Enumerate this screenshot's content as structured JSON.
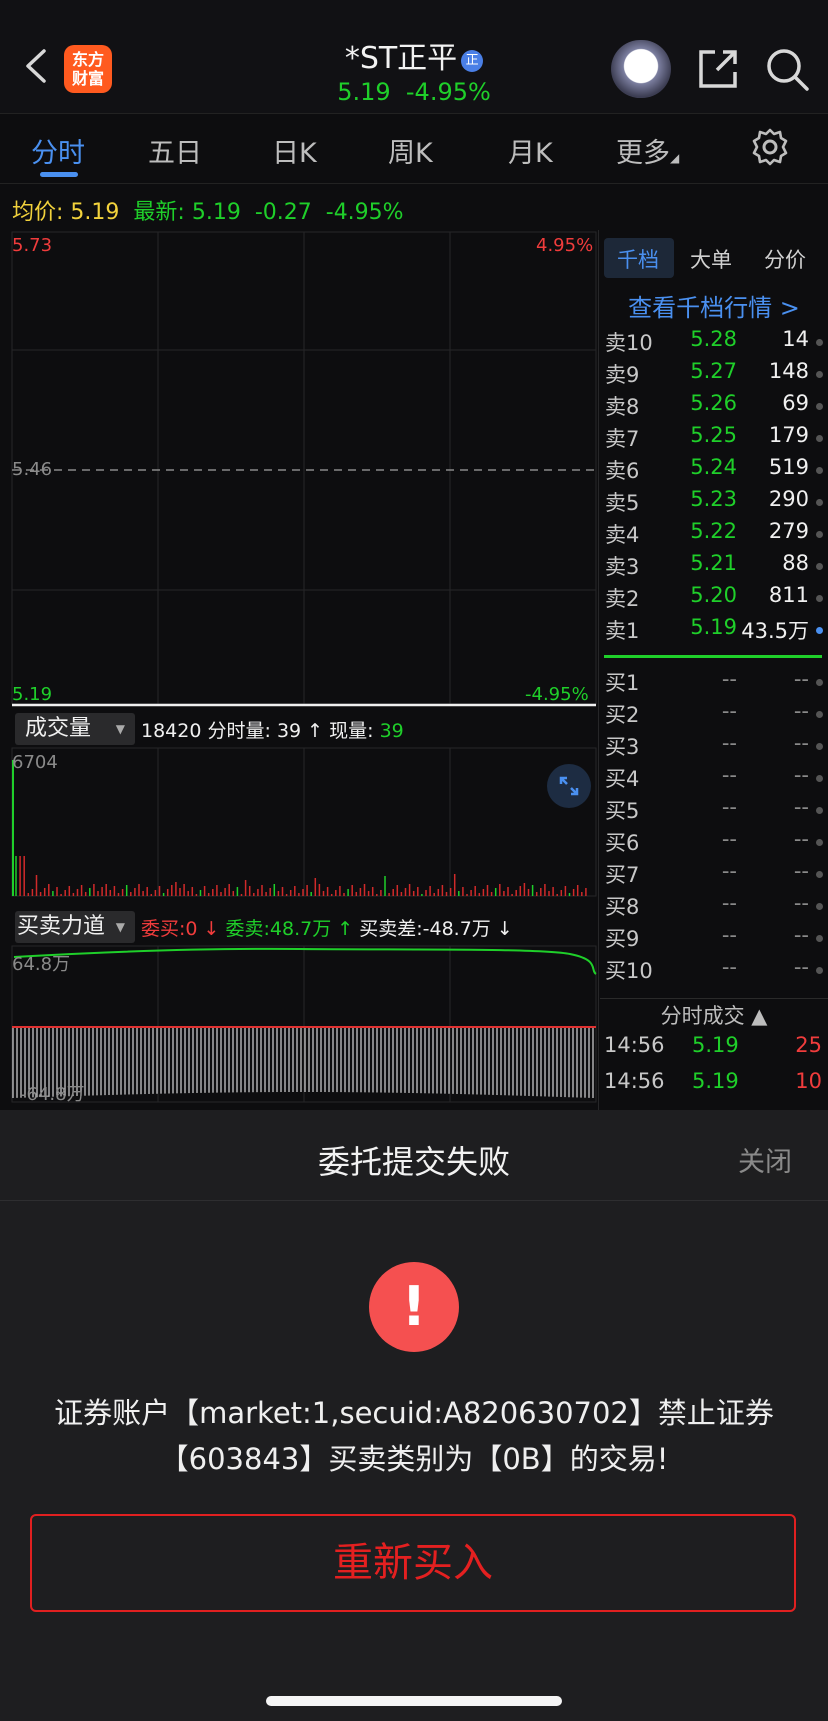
{
  "header": {
    "logo_text": "东方\n财富",
    "stock_name": "*ST正平",
    "badge": "正",
    "price": "5.19",
    "change_pct": "-4.95%"
  },
  "tabs": [
    "分时",
    "五日",
    "日K",
    "周K",
    "月K",
    "更多"
  ],
  "info_line": {
    "avg_label": "均价:",
    "avg_value": "5.19",
    "latest_label": "最新:",
    "latest_value": "5.19",
    "change": "-0.27",
    "change_pct": "-4.95%"
  },
  "price_chart": {
    "top_price": "5.73",
    "top_pct": "4.95%",
    "mid_price": "5.46",
    "bottom_price": "5.19",
    "bottom_pct": "-4.95%"
  },
  "volume": {
    "selector": "成交量",
    "total": "18420",
    "minute_label": "分时量:",
    "minute_value": "39",
    "now_label": "现量:",
    "now_value": "39",
    "max_label": "6704"
  },
  "force": {
    "selector": "买卖力道",
    "bid_label": "委买:0 ↓",
    "ask_label": "委卖:48.7万 ↑",
    "diff_label": "买卖差:-48.7万 ↓",
    "top_label": "64.8万",
    "bottom_label": "-64.8万"
  },
  "right_panel": {
    "tabs": [
      "千档",
      "大单",
      "分价"
    ],
    "view_depth": "查看千档行情 >",
    "asks": [
      {
        "label": "卖10",
        "price": "5.28",
        "qty": "14"
      },
      {
        "label": "卖9",
        "price": "5.27",
        "qty": "148"
      },
      {
        "label": "卖8",
        "price": "5.26",
        "qty": "69"
      },
      {
        "label": "卖7",
        "price": "5.25",
        "qty": "179"
      },
      {
        "label": "卖6",
        "price": "5.24",
        "qty": "519"
      },
      {
        "label": "卖5",
        "price": "5.23",
        "qty": "290"
      },
      {
        "label": "卖4",
        "price": "5.22",
        "qty": "279"
      },
      {
        "label": "卖3",
        "price": "5.21",
        "qty": "88"
      },
      {
        "label": "卖2",
        "price": "5.20",
        "qty": "811"
      },
      {
        "label": "卖1",
        "price": "5.19",
        "qty": "43.5万"
      }
    ],
    "bids": [
      {
        "label": "买1",
        "price": "--",
        "qty": "--"
      },
      {
        "label": "买2",
        "price": "--",
        "qty": "--"
      },
      {
        "label": "买3",
        "price": "--",
        "qty": "--"
      },
      {
        "label": "买4",
        "price": "--",
        "qty": "--"
      },
      {
        "label": "买5",
        "price": "--",
        "qty": "--"
      },
      {
        "label": "买6",
        "price": "--",
        "qty": "--"
      },
      {
        "label": "买7",
        "price": "--",
        "qty": "--"
      },
      {
        "label": "买8",
        "price": "--",
        "qty": "--"
      },
      {
        "label": "买9",
        "price": "--",
        "qty": "--"
      },
      {
        "label": "买10",
        "price": "--",
        "qty": "--"
      }
    ],
    "trades_title": "分时成交 ▲",
    "trades": [
      {
        "time": "14:56",
        "price": "5.19",
        "qty": "25"
      },
      {
        "time": "14:56",
        "price": "5.19",
        "qty": "10"
      }
    ]
  },
  "dialog": {
    "title": "委托提交失败",
    "close": "关闭",
    "icon": "!",
    "message_line1": "证券账户【market:1,secuid:A820630702】禁止证券",
    "message_line2": "【603843】买卖类别为【0B】的交易!",
    "rebuy": "重新买入"
  }
}
